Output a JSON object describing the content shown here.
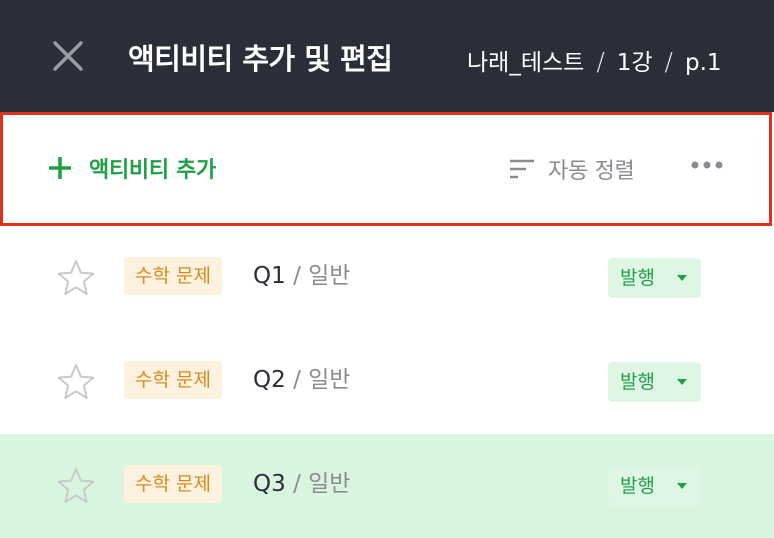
{
  "header": {
    "title": "액티비티 추가 및 편집",
    "breadcrumb": [
      "나래_테스트",
      "1강",
      "p.1"
    ],
    "breadcrumb_separator": "/"
  },
  "toolbar": {
    "add_label": "액티비티 추가",
    "sort_label": "자동 정렬"
  },
  "items": [
    {
      "tag": "수학 문제",
      "name": "Q1",
      "separator": "/",
      "type": "일반",
      "status": "발행"
    },
    {
      "tag": "수학 문제",
      "name": "Q2",
      "separator": "/",
      "type": "일반",
      "status": "발행"
    },
    {
      "tag": "수학 문제",
      "name": "Q3",
      "separator": "/",
      "type": "일반",
      "status": "발행"
    }
  ],
  "colors": {
    "header_bg": "#2b2e38",
    "accent_green": "#21a048",
    "tag_bg": "#fdf1df",
    "tag_text": "#d98a18",
    "highlight_row": "#d9f5df",
    "focus_border": "#e0311b"
  }
}
